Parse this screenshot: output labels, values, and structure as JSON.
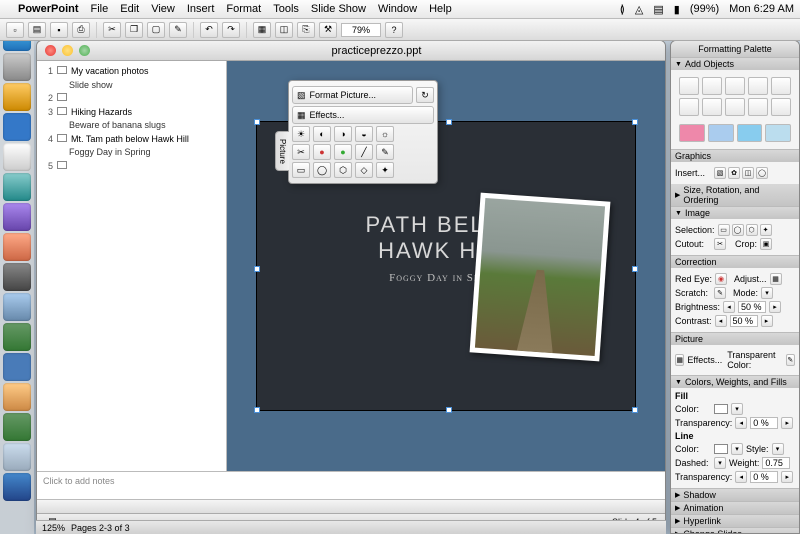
{
  "menubar": {
    "app": "PowerPoint",
    "items": [
      "File",
      "Edit",
      "View",
      "Insert",
      "Format",
      "Tools",
      "Slide Show",
      "Window",
      "Help"
    ],
    "battery": "(99%)",
    "clock": "Mon 6:29 AM"
  },
  "toolbar": {
    "zoom": "79%"
  },
  "window": {
    "title": "practiceprezzo.ppt",
    "outline": [
      {
        "n": "1",
        "title": "My vacation photos",
        "subs": [
          "Slide show"
        ]
      },
      {
        "n": "2",
        "title": "",
        "subs": []
      },
      {
        "n": "3",
        "title": "Hiking Hazards",
        "subs": [
          "Beware of banana slugs"
        ]
      },
      {
        "n": "4",
        "title": "Mt. Tam path below Hawk Hill",
        "subs": [
          "Foggy Day in Spring"
        ]
      },
      {
        "n": "5",
        "title": "",
        "subs": []
      }
    ],
    "slide": {
      "title_l1": "path below",
      "title_l2": "Hawk Hill",
      "subtitle": "Foggy Day in Spring"
    },
    "notes_placeholder": "Click to add notes",
    "slide_counter": "Slide 4 of 5"
  },
  "picture_toolbar": {
    "tab": "Picture",
    "format": "Format Picture...",
    "effects": "Effects..."
  },
  "palette": {
    "title": "Formatting Palette",
    "sections": {
      "add_objects": "Add Objects",
      "graphics": "Graphics",
      "image": "Image",
      "correction": "Correction",
      "picture": "Picture",
      "colors": "Colors, Weights, and Fills",
      "shadow": "Shadow",
      "animation": "Animation",
      "hyperlink": "Hyperlink",
      "change_slides": "Change Slides"
    },
    "graphics_rows": {
      "insert": "Insert...",
      "size": "Size, Rotation, and Ordering"
    },
    "image_rows": {
      "selection": "Selection:",
      "cutout": "Cutout:",
      "crop": "Crop:"
    },
    "correction_rows": {
      "redeye": "Red Eye:",
      "adjust": "Adjust...",
      "scratch": "Scratch:",
      "mode": "Mode:",
      "brightness": "Brightness:",
      "brightness_v": "50 %",
      "contrast": "Contrast:",
      "contrast_v": "50 %"
    },
    "picture_rows": {
      "effects": "Effects...",
      "transparent": "Transparent Color:"
    },
    "cwf": {
      "fill": "Fill",
      "color": "Color:",
      "transparency": "Transparency:",
      "t_v": "0 %",
      "line": "Line",
      "style": "Style:",
      "dashed": "Dashed:",
      "weight": "Weight:",
      "weight_v": "0.75"
    }
  },
  "bottom": {
    "zoom": "125%",
    "pages": "Pages 2-3 of 3"
  }
}
